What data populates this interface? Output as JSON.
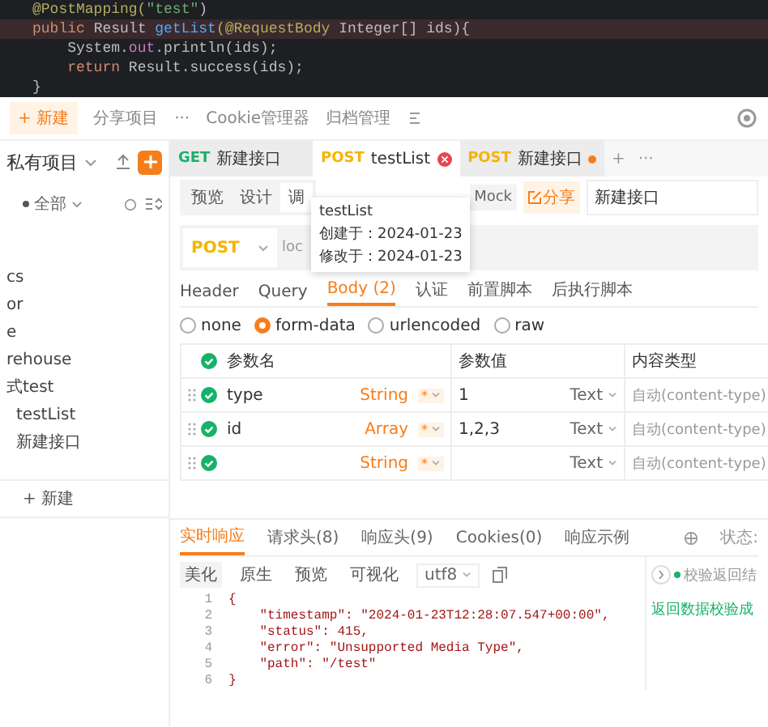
{
  "editor": {
    "lines": [
      [
        {
          "t": "@PostMapping(",
          "kind": "annotation"
        },
        {
          "t": "\"test\"",
          "kind": "string"
        },
        {
          "t": ")",
          "kind": "plain"
        }
      ],
      [
        {
          "t": "public ",
          "kind": "keyword"
        },
        {
          "t": "Result ",
          "kind": "plain"
        },
        {
          "t": "getList",
          "kind": "method"
        },
        {
          "t": "(@RequestBody ",
          "kind": "annotation"
        },
        {
          "t": "Integer[] ids){",
          "kind": "plain"
        }
      ],
      [
        {
          "t": "    System.",
          "kind": "plain"
        },
        {
          "t": "out",
          "kind": "field"
        },
        {
          "t": ".println(ids);",
          "kind": "plain"
        }
      ],
      [
        {
          "t": "    return ",
          "kind": "keyword"
        },
        {
          "t": "Result.success(ids);",
          "kind": "plain"
        }
      ],
      [
        {
          "t": "}",
          "kind": "plain"
        }
      ]
    ]
  },
  "toolbar": {
    "new_button": "+ 新建",
    "items": [
      "分享项目",
      "···",
      "Cookie管理器",
      "归档管理"
    ]
  },
  "sidebar": {
    "project": "私有项目",
    "filter": "全部",
    "items": [
      {
        "label": "cs"
      },
      {
        "label": "or"
      },
      {
        "label": "e"
      },
      {
        "label": "rehouse"
      },
      {
        "label": "式test",
        "children": [
          {
            "label": "testList"
          },
          {
            "label": "新建接口"
          }
        ]
      }
    ],
    "new_button": "+ 新建"
  },
  "tabs": [
    {
      "method": "GET",
      "title": "新建接口",
      "selected": false,
      "closable": false,
      "unsaved": false
    },
    {
      "method": "POST",
      "title": "testList",
      "selected": true,
      "closable": true,
      "unsaved": false
    },
    {
      "method": "POST",
      "title": "新建接口",
      "selected": false,
      "closable": false,
      "unsaved": true
    }
  ],
  "tab_actions": [
    "+",
    "···"
  ],
  "modes": [
    {
      "label": "预览",
      "selected": false
    },
    {
      "label": "设计",
      "selected": false
    },
    {
      "label": "调",
      "selected": true
    }
  ],
  "mock_button": "Mock",
  "share_button": "分享",
  "name_field": "新建接口",
  "tooltip": {
    "title": "testList",
    "created": "创建于：2024-01-23",
    "modified": "修改于：2024-01-23"
  },
  "request": {
    "method": "POST",
    "url": "loc"
  },
  "request_tabs": [
    {
      "label": "Header",
      "selected": false
    },
    {
      "label": "Query",
      "selected": false
    },
    {
      "label": "Body (2)",
      "selected": true
    },
    {
      "label": "认证",
      "selected": false
    },
    {
      "label": "前置脚本",
      "selected": false
    },
    {
      "label": "后执行脚本",
      "selected": false
    }
  ],
  "body_types": [
    {
      "label": "none",
      "selected": false
    },
    {
      "label": "form-data",
      "selected": true
    },
    {
      "label": "urlencoded",
      "selected": false
    },
    {
      "label": "raw",
      "selected": false
    }
  ],
  "params": {
    "columns": [
      "参数名",
      "参数值",
      "内容类型"
    ],
    "rows": [
      {
        "checked": true,
        "name": "type",
        "type": "String",
        "required": "*",
        "value": "1",
        "value_type": "Text",
        "content_type": "自动(content-type)"
      },
      {
        "checked": true,
        "name": "id",
        "type": "Array",
        "required": "*",
        "value": "1,2,3",
        "value_type": "Text",
        "content_type": "自动(content-type)"
      },
      {
        "checked": true,
        "type": "String",
        "required": "*",
        "value_type": "Text",
        "content_type": "自动(content-type)"
      }
    ]
  },
  "response": {
    "tabs": [
      {
        "label": "实时响应",
        "selected": true
      },
      {
        "label": "请求头(8)",
        "selected": false
      },
      {
        "label": "响应头(9)",
        "selected": false
      },
      {
        "label": "Cookies(0)",
        "selected": false
      },
      {
        "label": "响应示例",
        "selected": false
      }
    ],
    "status_label": "状态:",
    "views": [
      {
        "label": "美化",
        "selected": true
      },
      {
        "label": "原生",
        "selected": false
      },
      {
        "label": "预览",
        "selected": false
      },
      {
        "label": "可视化",
        "selected": false
      }
    ],
    "encoding": "utf8",
    "lines": [
      {
        "number": "1",
        "text": "{"
      },
      {
        "number": "2",
        "text": "    \"timestamp\": \"2024-01-23T12:28:07.547+00:00\","
      },
      {
        "number": "3",
        "text": "    \"status\": 415,"
      },
      {
        "number": "4",
        "text": "    \"error\": \"Unsupported Media Type\","
      },
      {
        "number": "5",
        "text": "    \"path\": \"/test\""
      },
      {
        "number": "6",
        "text": "}"
      }
    ],
    "check_label": "校验返回结",
    "check_result": "返回数据校验成"
  }
}
